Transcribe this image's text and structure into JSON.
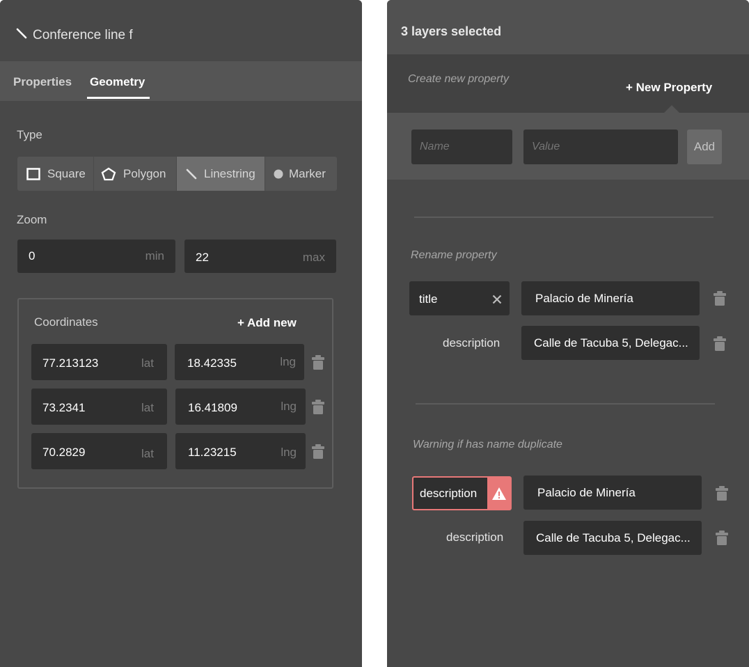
{
  "left": {
    "title": "Conference line f",
    "tabs": [
      {
        "label": "Properties"
      },
      {
        "label": "Geometry"
      }
    ],
    "type_label": "Type",
    "types": [
      {
        "label": "Square",
        "icon": "square-icon"
      },
      {
        "label": "Polygon",
        "icon": "polygon-icon"
      },
      {
        "label": "Linestring",
        "icon": "linestring-icon",
        "active": true
      },
      {
        "label": "Marker",
        "icon": "marker-icon"
      }
    ],
    "zoom_label": "Zoom",
    "zoom": {
      "min": {
        "value": "0",
        "unit": "min"
      },
      "max": {
        "value": "22",
        "unit": "max"
      }
    },
    "coordinates_label": "Coordinates",
    "add_new": "+ Add new",
    "coordinates": [
      {
        "lat": "77.213123",
        "lng": "18.42335",
        "lat_unit": "lat",
        "lng_unit": "lng"
      },
      {
        "lat": "73.2341",
        "lng": "16.41809",
        "lat_unit": "lat",
        "lng_unit": "lng"
      },
      {
        "lat": "70.2829",
        "lng": "11.23215",
        "lat_unit": "lat",
        "lng_unit": "lng"
      }
    ]
  },
  "right": {
    "title": "3 layers selected",
    "create_hint": "Create new property",
    "new_property_button": "+ New Property",
    "name_placeholder": "Name",
    "value_placeholder": "Value",
    "add_button": "Add",
    "rename_label": "Rename property",
    "rename_rows": [
      {
        "key": "title",
        "value": "Palacio de Minería"
      },
      {
        "key": "description",
        "value": "Calle de Tacuba 5, Delegac..."
      }
    ],
    "warning_label": "Warning if has name duplicate",
    "warning_rows": [
      {
        "key": "description",
        "value": "Palacio de Minería"
      },
      {
        "key": "description",
        "value": "Calle de Tacuba 5, Delegac..."
      }
    ]
  },
  "colors": {
    "panel_bg": "#484848",
    "field_bg": "#2f2f2f",
    "warning": "#e87878"
  }
}
